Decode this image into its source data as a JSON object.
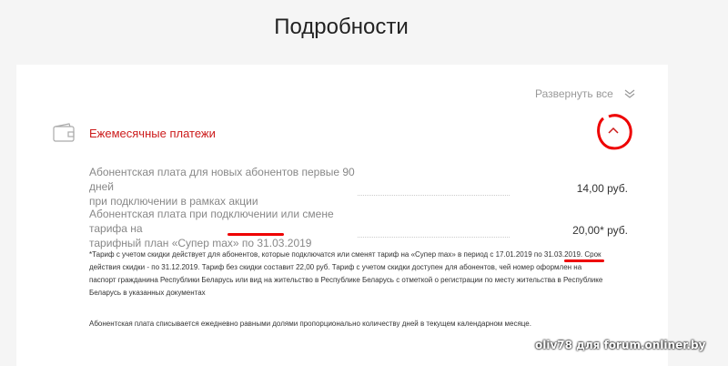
{
  "page": {
    "title": "Подробности"
  },
  "toolbar": {
    "expand_all_label": "Развернуть все",
    "expand_icon": "double-chevron-down-icon"
  },
  "section": {
    "title": "Ежемесячные платежи",
    "icon": "wallet-icon",
    "collapse_icon": "chevron-up-icon",
    "accent_color": "#cc1b1b"
  },
  "rows": [
    {
      "desc_line1": "Абонентская плата для новых абонентов первые 90 дней",
      "desc_line2": "при подключении в рамках акции",
      "price": "14,00 руб."
    },
    {
      "desc_line1": "Абонентская плата при подключении или смене тарифа на",
      "desc_line2": "тарифный план «Супер max» по 31.03.2019",
      "price": "20,00* руб."
    }
  ],
  "notes": {
    "footnote_line1": "*Тариф с учетом скидки действует для абонентов, которые подключатся или сменят тариф на «Супер max» в период с 17.01.2019 по 31.03.2019. Срок",
    "footnote_line2": "действия скидки - по 31.12.2019. Тариф без скидки составит 22,00 руб. Тариф с учетом скидки доступен для абонентов, чей номер оформлен на",
    "footnote_line3": "паспорт гражданина Республики Беларусь или вид на жительство в Республике Беларусь с отметкой о регистрации по месту жительства в Республике",
    "footnote_line4": "Беларусь в указанных документах",
    "billing_note": "Абонентская плата списывается ежедневно равными долями пропорционально количеству дней в текущем календарном месяце."
  },
  "watermark": "oliv78 для forum.onliner.by",
  "annotation_color": "#ee0000"
}
